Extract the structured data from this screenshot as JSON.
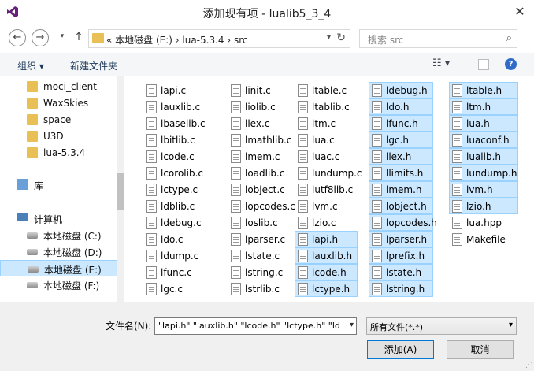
{
  "window": {
    "title": "添加现有项 - lualib5_3_4",
    "close_glyph": "✕"
  },
  "nav": {
    "back": "←",
    "forward": "→",
    "up": "↑",
    "path": "« 本地磁盘 (E:) › lua-5.3.4 › src",
    "search_placeholder": "搜索 src"
  },
  "toolbar": {
    "organize": "组织 ▾",
    "new_folder": "新建文件夹"
  },
  "sidebar": {
    "items": [
      {
        "label": "moci_client",
        "icon": "folder-icon"
      },
      {
        "label": "WaxSkies",
        "icon": "folder-icon"
      },
      {
        "label": "space",
        "icon": "folder-icon"
      },
      {
        "label": "U3D",
        "icon": "folder-icon"
      },
      {
        "label": "lua-5.3.4",
        "icon": "folder-icon"
      },
      {
        "label": "库",
        "icon": "library-icon"
      },
      {
        "label": "计算机",
        "icon": "computer-icon"
      },
      {
        "label": "本地磁盘 (C:)",
        "icon": "drive-icon"
      },
      {
        "label": "本地磁盘 (D:)",
        "icon": "drive-icon"
      },
      {
        "label": "本地磁盘 (E:)",
        "icon": "drive-icon",
        "selected": true
      },
      {
        "label": "本地磁盘 (F:)",
        "icon": "drive-icon"
      }
    ]
  },
  "files": {
    "columns": [
      [
        "lapi.c",
        "lauxlib.c",
        "lbaselib.c",
        "lbitlib.c",
        "lcode.c",
        "lcorolib.c",
        "lctype.c",
        "ldblib.c",
        "ldebug.c",
        "ldo.c",
        "ldump.c",
        "lfunc.c",
        "lgc.c"
      ],
      [
        "linit.c",
        "liolib.c",
        "llex.c",
        "lmathlib.c",
        "lmem.c",
        "loadlib.c",
        "lobject.c",
        "lopcodes.c",
        "loslib.c",
        "lparser.c",
        "lstate.c",
        "lstring.c",
        "lstrlib.c"
      ],
      [
        "ltable.c",
        "ltablib.c",
        "ltm.c",
        "lua.c",
        "luac.c",
        "lundump.c",
        "lutf8lib.c",
        "lvm.c",
        "lzio.c",
        "lapi.h",
        "lauxlib.h",
        "lcode.h",
        "lctype.h"
      ],
      [
        "ldebug.h",
        "ldo.h",
        "lfunc.h",
        "lgc.h",
        "llex.h",
        "llimits.h",
        "lmem.h",
        "lobject.h",
        "lopcodes.h",
        "lparser.h",
        "lprefix.h",
        "lstate.h",
        "lstring.h"
      ],
      [
        "ltable.h",
        "ltm.h",
        "lua.h",
        "luaconf.h",
        "lualib.h",
        "lundump.h",
        "lvm.h",
        "lzio.h",
        "lua.hpp",
        "Makefile"
      ]
    ]
  },
  "footer": {
    "filename_label": "文件名(N):",
    "filename_value": "\"lapi.h\" \"lauxlib.h\" \"lcode.h\" \"lctype.h\" \"ld",
    "filetype": "所有文件(*.*)",
    "add_button": "添加(A)",
    "cancel_button": "取消"
  }
}
